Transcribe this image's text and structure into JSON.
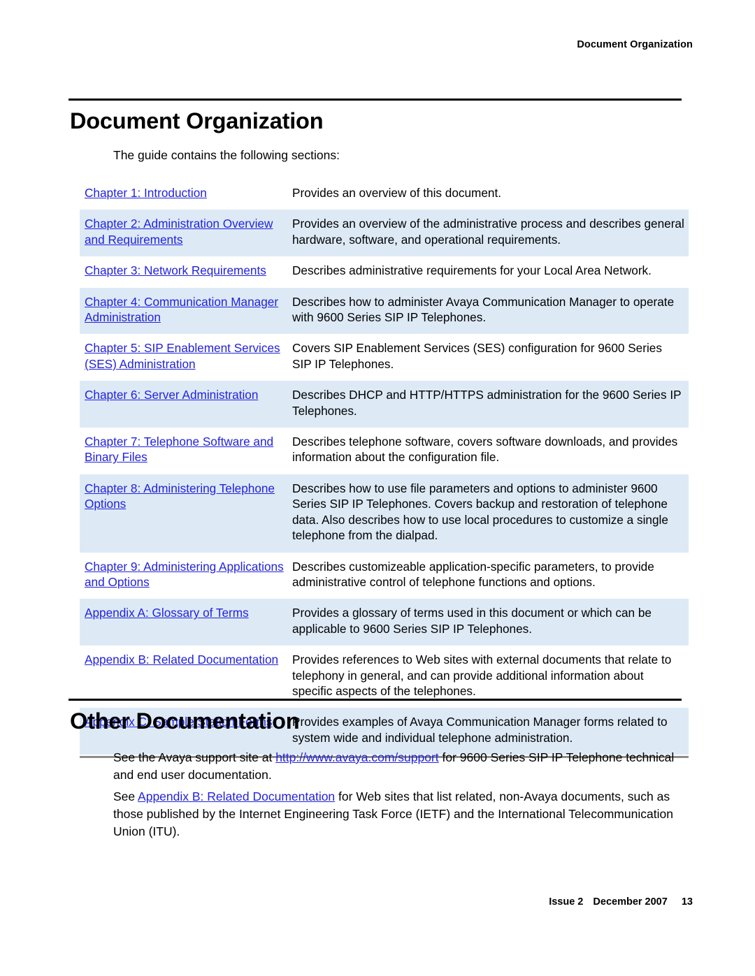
{
  "header": {
    "running_head": "Document Organization"
  },
  "section1": {
    "title": "Document Organization",
    "intro": "The guide contains the following sections:"
  },
  "chapter_table": {
    "rows": [
      {
        "link": "Chapter 1: Introduction",
        "description": "Provides an overview of this document.",
        "shaded": false
      },
      {
        "link": "Chapter 2: Administration Overview and Requirements",
        "description": "Provides an overview of the administrative process and describes general hardware, software, and operational requirements.",
        "shaded": true
      },
      {
        "link": "Chapter 3: Network Requirements",
        "description": "Describes administrative requirements for your Local Area Network.",
        "shaded": false
      },
      {
        "link": "Chapter 4: Communication Manager Administration",
        "description": "Describes how to administer Avaya Communication Manager to operate with 9600 Series SIP IP Telephones.",
        "shaded": true
      },
      {
        "link": "Chapter 5: SIP Enablement Services (SES) Administration",
        "description": "Covers SIP Enablement Services (SES) configuration for 9600 Series SIP IP Telephones.",
        "shaded": false
      },
      {
        "link": "Chapter 6: Server Administration",
        "description": "Describes DHCP and HTTP/HTTPS administration for the 9600 Series IP Telephones.",
        "shaded": true
      },
      {
        "link": "Chapter 7: Telephone Software and Binary Files",
        "description": "Describes telephone software, covers software downloads, and provides information about the configuration file.",
        "shaded": false
      },
      {
        "link": "Chapter 8: Administering Telephone Options",
        "description": "Describes how to use file parameters and options to administer 9600 Series SIP IP Telephones. Covers backup and restoration of telephone data. Also describes how to use local procedures to customize a single telephone from the dialpad.",
        "shaded": true
      },
      {
        "link": "Chapter 9: Administering Applications and Options",
        "description": "Describes customizeable application-specific parameters, to provide administrative control of telephone functions and options.",
        "shaded": false
      },
      {
        "link": "Appendix A: Glossary of Terms",
        "description": "Provides a glossary of terms used in this document or which can be applicable to 9600 Series SIP IP Telephones.",
        "shaded": true
      },
      {
        "link": "Appendix B: Related Documentation",
        "description": "Provides references to Web sites with external documents that relate to telephony in general, and can provide additional information about specific aspects of the telephones.",
        "shaded": false
      },
      {
        "link": "Appendix C: Sample Station Forms",
        "description": "Provides examples of Avaya Communication Manager forms related to system wide and individual telephone administration.",
        "shaded": true
      }
    ]
  },
  "section2": {
    "title": "Other Documentation",
    "para1_before": "See the Avaya support site at ",
    "para1_link": "http://www.avaya.com/support",
    "para1_after": " for 9600 Series SIP IP Telephone technical and end user documentation.",
    "para2_before": "See ",
    "para2_link": "Appendix B: Related Documentation",
    "para2_after": " for Web sites that list related, non-Avaya documents, such as those published by the Internet Engineering Task Force (IETF) and the International Telecommunication Union (ITU)."
  },
  "footer": {
    "issue": "Issue 2",
    "date": "December 2007",
    "page_number": "13"
  },
  "colors": {
    "link": "#2222dd",
    "row_shade": "#ddeaf6",
    "rule_black": "#000000",
    "rule_gray": "#8d8d8d"
  }
}
